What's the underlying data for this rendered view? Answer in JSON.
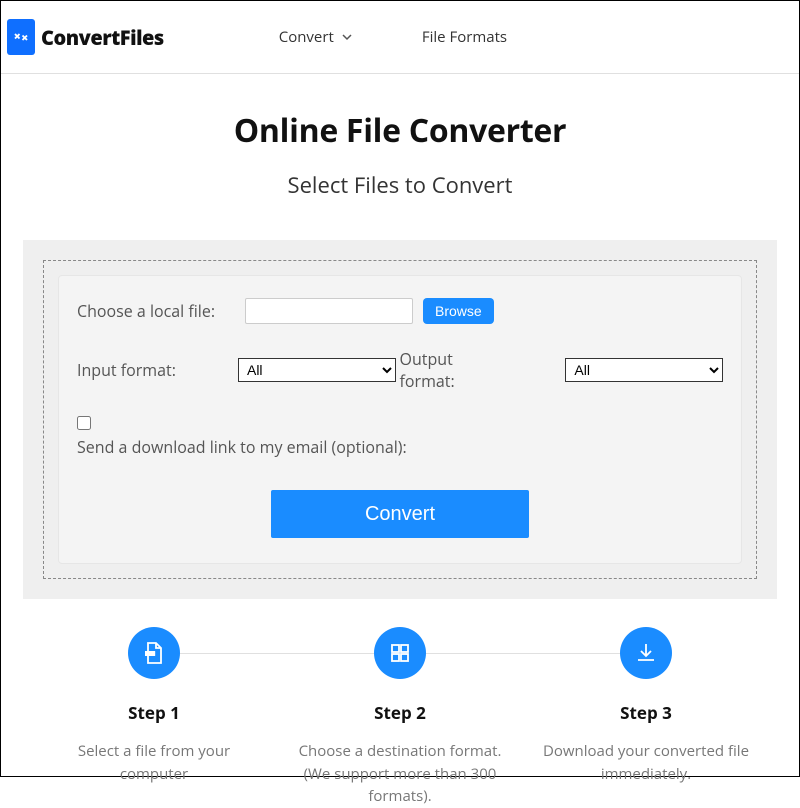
{
  "header": {
    "logo_text": "ConvertFiles",
    "nav": [
      {
        "label": "Convert",
        "has_dropdown": true
      },
      {
        "label": "File Formats",
        "has_dropdown": false
      }
    ]
  },
  "hero": {
    "title": "Online File Converter",
    "subtitle": "Select Files to Convert"
  },
  "form": {
    "choose_file_label": "Choose a local file:",
    "browse_button": "Browse",
    "input_format_label": "Input format:",
    "input_format_value": "All",
    "output_format_label": "Output format:",
    "output_format_value": "All",
    "email_checkbox_label": "Send a download link to my email (optional):",
    "convert_button": "Convert"
  },
  "steps": [
    {
      "title": "Step 1",
      "desc": "Select a file from your computer"
    },
    {
      "title": "Step 2",
      "desc": "Choose a destination format. (We support more than 300 formats)."
    },
    {
      "title": "Step 3",
      "desc": "Download your converted file immediately."
    }
  ]
}
